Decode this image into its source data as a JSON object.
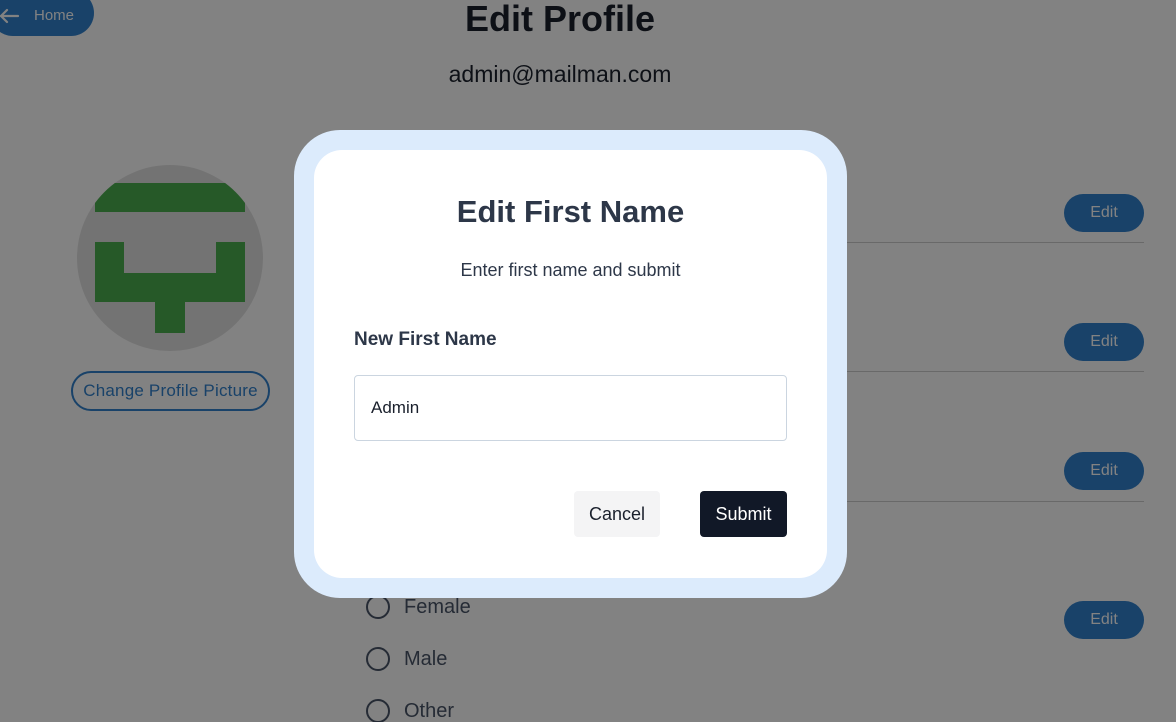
{
  "background": {
    "home_label": "Home",
    "page_title": "Edit Profile",
    "email": "admin@mailman.com",
    "change_picture_label": "Change Profile Picture",
    "edit_label": "Edit",
    "gender_options": [
      "Female",
      "Male",
      "Other"
    ]
  },
  "modal": {
    "title": "Edit First Name",
    "subtitle": "Enter first name and submit",
    "field_label": "New First Name",
    "field_value": "Admin",
    "cancel_label": "Cancel",
    "submit_label": "Submit"
  },
  "colors": {
    "accent": "#3182ce",
    "overlay": "rgba(0,0,0,0.49)",
    "modal_frame": "#dcebfc",
    "submit": "#111827",
    "avatar_green": "#4caf50"
  },
  "icons": {
    "home": "arrow-left-icon",
    "avatar": "identicon"
  }
}
